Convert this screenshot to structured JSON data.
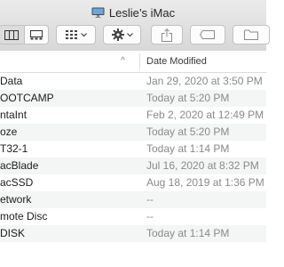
{
  "window": {
    "title": "Leslie’s iMac"
  },
  "toolbar": {
    "view_buttons": [
      "columns-view",
      "gallery-view"
    ],
    "group_by_icon": "grid-icon",
    "action_icon": "gear-icon",
    "share_icon": "share-icon",
    "tags_icon": "tag-icon",
    "new_folder_icon": "folder-icon"
  },
  "columns": {
    "name": "",
    "date_modified": "Date Modified"
  },
  "rows": [
    {
      "name": " Data",
      "date": "Jan 29, 2020 at 3:50 PM"
    },
    {
      "name": "OOTCAMP",
      "date": "Today at 5:20 PM"
    },
    {
      "name": "ntaInt",
      "date": "Feb 2, 2020 at 12:49 PM"
    },
    {
      "name": "oze",
      "date": "Today at 5:20 PM"
    },
    {
      "name": "T32-1",
      "date": "Today at 1:14 PM"
    },
    {
      "name": "acBlade",
      "date": "Jul 16, 2020 at 8:32 PM"
    },
    {
      "name": "acSSD",
      "date": "Aug 18, 2019 at 1:36 PM"
    },
    {
      "name": "etwork",
      "date": "--"
    },
    {
      "name": "mote Disc",
      "date": "--"
    },
    {
      "name": "DISK",
      "date": "Today at 1:14 PM"
    }
  ]
}
